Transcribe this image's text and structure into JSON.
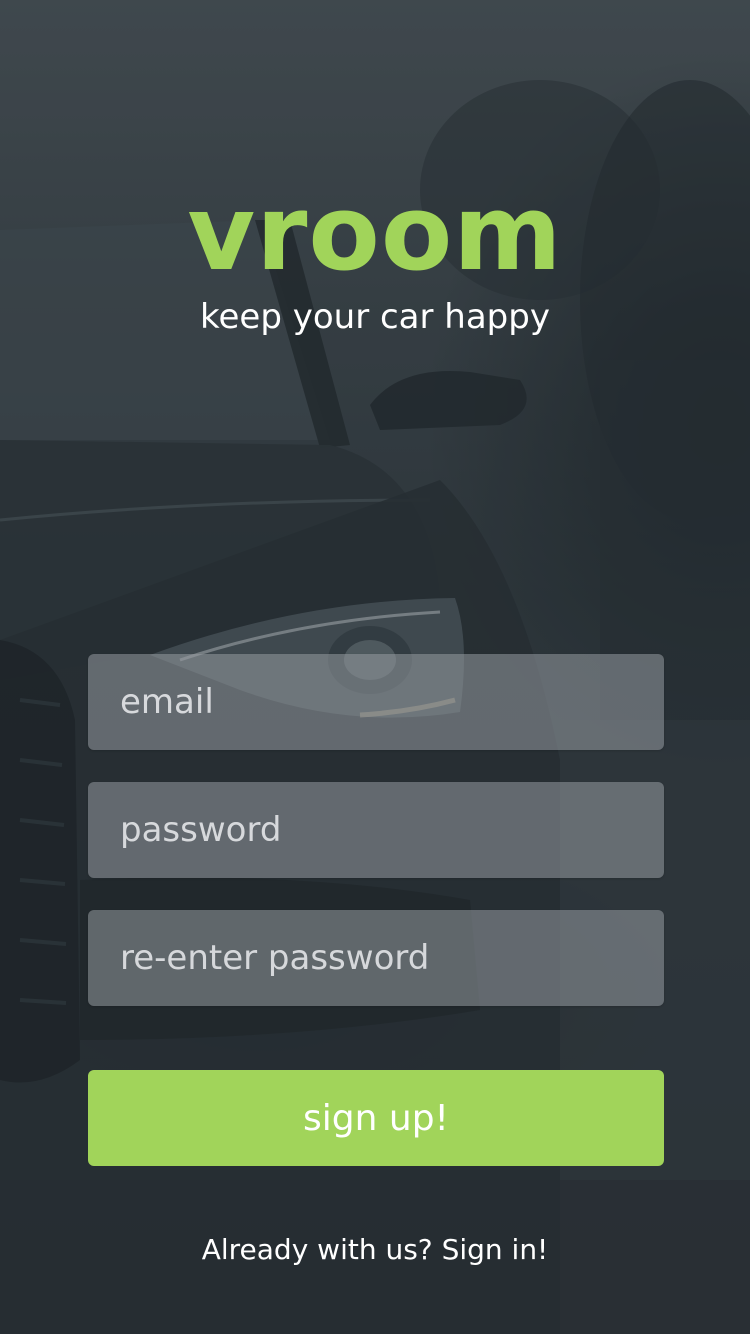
{
  "brand": {
    "logo_text": "vroom",
    "tagline": "keep your car happy",
    "accent_color": "#a1d45a"
  },
  "form": {
    "email_placeholder": "email",
    "password_placeholder": "password",
    "reenter_placeholder": "re-enter password",
    "submit_label": "sign up!"
  },
  "footer": {
    "signin_text": "Already with us? Sign in!"
  },
  "background": {
    "image_subject": "dark car front with headlight, blurred trees"
  }
}
